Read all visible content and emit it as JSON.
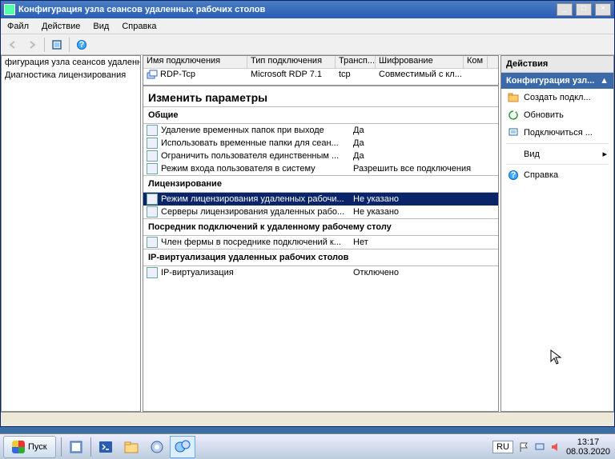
{
  "title": "Конфигурация узла сеансов удаленных рабочих столов",
  "menu": {
    "file": "Файл",
    "action": "Действие",
    "view": "Вид",
    "help": "Справка"
  },
  "tree": {
    "t1": "фигурация узла сеансов удаленных",
    "t2": "Диагностика лицензирования"
  },
  "list": {
    "headers": {
      "c1": "Имя подключения",
      "c2": "Тип подключения",
      "c3": "Трансп...",
      "c4": "Шифрование",
      "c5": "Ком"
    },
    "row1": {
      "c1": "RDP-Tcp",
      "c2": "Microsoft RDP 7.1",
      "c3": "tcp",
      "c4": "Совместимый с кл..."
    }
  },
  "section": "Изменить параметры",
  "groups": {
    "g1": "Общие",
    "g1r1": {
      "n": "Удаление временных папок при выходе",
      "v": "Да"
    },
    "g1r2": {
      "n": "Использовать временные папки для сеан...",
      "v": "Да"
    },
    "g1r3": {
      "n": "Ограничить пользователя единственным ...",
      "v": "Да"
    },
    "g1r4": {
      "n": "Режим входа пользователя в систему",
      "v": "Разрешить все подключения"
    },
    "g2": "Лицензирование",
    "g2r1": {
      "n": "Режим лицензирования удаленных рабочи...",
      "v": "Не указано"
    },
    "g2r2": {
      "n": "Серверы лицензирования удаленных рабо...",
      "v": "Не указано"
    },
    "g3": "Посредник подключений к удаленному рабочему столу",
    "g3r1": {
      "n": "Член фермы в посреднике подключений к...",
      "v": "Нет"
    },
    "g4": "IP-виртуализация удаленных рабочих столов",
    "g4r1": {
      "n": "IP-виртуализация",
      "v": "Отключено"
    }
  },
  "actions": {
    "hdr": "Действия",
    "hdr2": "Конфигурация узл...",
    "a1": "Создать подкл...",
    "a2": "Обновить",
    "a3": "Подключиться ...",
    "a4": "Вид",
    "a5": "Справка"
  },
  "taskbar": {
    "start": "Пуск",
    "lang": "RU",
    "time": "13:17",
    "date": "08.03.2020"
  }
}
